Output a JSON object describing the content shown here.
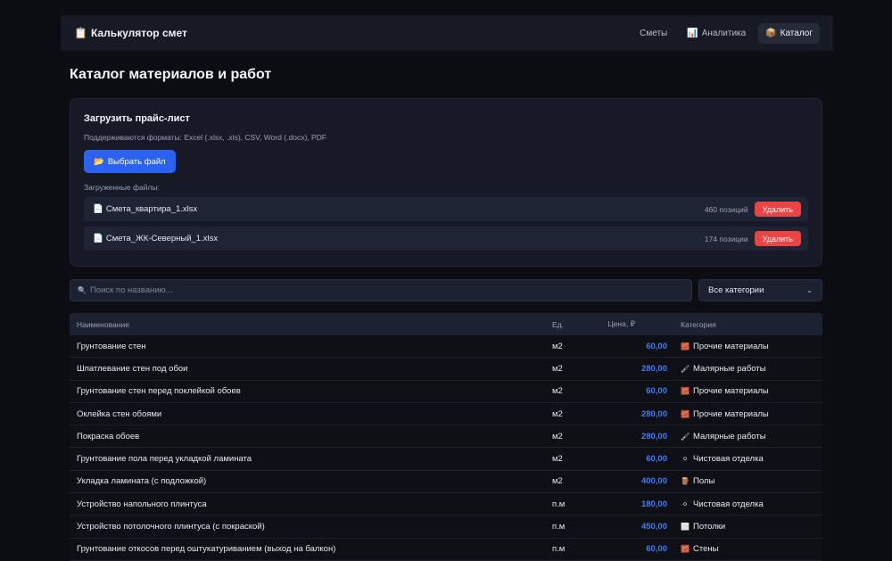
{
  "navbar": {
    "brand_icon": "📋",
    "brand": "Калькулятор смет",
    "links": [
      {
        "icon": "",
        "label": "Сметы",
        "active": false
      },
      {
        "icon": "📊",
        "label": "Аналитика",
        "active": false
      },
      {
        "icon": "📦",
        "label": "Каталог",
        "active": true
      }
    ]
  },
  "page": {
    "title": "Каталог материалов и работ"
  },
  "upload": {
    "title": "Загрузить прайс-лист",
    "formats": "Поддерживаются форматы: Excel (.xlsx, .xls), CSV, Word (.docx), PDF",
    "button_icon": "📂",
    "button_label": "Выбрать файл",
    "loaded_label": "Загруженные файлы:",
    "files": [
      {
        "icon": "📄",
        "name": "Смета_квартира_1.xlsx",
        "count": "460 позиций",
        "delete_label": "Удалить"
      },
      {
        "icon": "📄",
        "name": "Смета_ЖК-Северный_1.xlsx",
        "count": "174 позиции",
        "delete_label": "Удалить"
      }
    ]
  },
  "filters": {
    "search_icon": "🔍",
    "search_placeholder": "Поиск по названию...",
    "category_selected": "Все категории",
    "chevron": "⌄"
  },
  "table": {
    "headers": {
      "name": "Наименование",
      "unit": "Ед.",
      "price": "Цена, ₽",
      "category": "Категория"
    },
    "rows": [
      {
        "name": "Грунтование стен",
        "unit": "м2",
        "price": "60,00",
        "cat_icon": "🧱",
        "category": "Прочие материалы"
      },
      {
        "name": "Шпатлевание стен под обои",
        "unit": "м2",
        "price": "280,00",
        "cat_icon": "🖌",
        "category": "Малярные работы"
      },
      {
        "name": "Грунтование стен перед поклейкой обоев",
        "unit": "м2",
        "price": "60,00",
        "cat_icon": "🧱",
        "category": "Прочие материалы"
      },
      {
        "name": "Оклейка стен обоями",
        "unit": "м2",
        "price": "280,00",
        "cat_icon": "🧱",
        "category": "Прочие материалы"
      },
      {
        "name": "Покраска обоев",
        "unit": "м2",
        "price": "280,00",
        "cat_icon": "🖌",
        "category": "Малярные работы"
      },
      {
        "name": "Грунтование пола перед укладкой ламината",
        "unit": "м2",
        "price": "60,00",
        "cat_icon": "⚪",
        "category": "Чистовая отделка"
      },
      {
        "name": "Укладка ламината (с подложкой)",
        "unit": "м2",
        "price": "400,00",
        "cat_icon": "🪵",
        "category": "Полы"
      },
      {
        "name": "Устройство напольного плинтуса",
        "unit": "п.м",
        "price": "180,00",
        "cat_icon": "⚪",
        "category": "Чистовая отделка"
      },
      {
        "name": "Устройство потолочного плинтуса (с покраской)",
        "unit": "п.м",
        "price": "450,00",
        "cat_icon": "⬜",
        "category": "Потолки"
      },
      {
        "name": "Грунтование откосов перед оштукатуриванием (выход на балкон)",
        "unit": "п.м",
        "price": "60,00",
        "cat_icon": "🧱",
        "category": "Стены"
      }
    ]
  },
  "colors": {
    "accent": "#2a63f0",
    "price": "#3f7cf5",
    "danger": "#ea4444",
    "background": "#0c0d12"
  }
}
